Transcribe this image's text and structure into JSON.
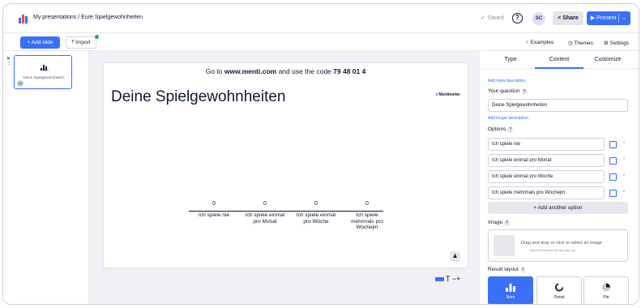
{
  "header": {
    "breadcrumb": "My presentations / Eure Spielgewohnheiten",
    "saved": "Saved",
    "help_glyph": "?",
    "avatar_initials": "SC",
    "share_label": "Share",
    "share_glyph": "<",
    "present_label": "Present",
    "present_glyph": "▶",
    "present_menu_glyph": "⌄",
    "check_glyph": "✓"
  },
  "toolbar": {
    "add_slide": "+ Add slide",
    "import": "Import",
    "import_glyph": "⤒",
    "examples": "Examples",
    "examples_glyph": "♀",
    "themes": "Themes",
    "themes_glyph": "◷",
    "settings": "Settings",
    "settings_glyph": "⚙"
  },
  "sidebar": {
    "slides": [
      {
        "number": "1",
        "title": "Deine Spielgewohnheiten",
        "avatar": "SC",
        "marker_glyph": "▶"
      }
    ]
  },
  "slide": {
    "banner_prefix": "Go to ",
    "banner_url": "www.menti.com",
    "banner_mid": " and use the code ",
    "banner_code": "79 48 01 4",
    "title": "Deine Spielgewohnheiten",
    "brand": "Mentimeter",
    "brand_glyph": "ıl",
    "user_glyph": "♟",
    "zoom_glyph": "T −+"
  },
  "chart_data": {
    "type": "bar",
    "categories": [
      "Ich spiele nie",
      "Ich spiele einmal pro Monat",
      "Ich spiele einmal pro Woche",
      "Ich spiele mehrmals pro Wochejm"
    ],
    "values": [
      0,
      0,
      0,
      0
    ]
  },
  "panel": {
    "tabs": [
      "Type",
      "Content",
      "Customize"
    ],
    "active_tab": "Content",
    "add_meta": "Add meta description",
    "question_label": "Your question",
    "question_value": "Deine Spielgewohnheiten",
    "add_longer": "Add longer description",
    "options_label": "Options",
    "options": [
      "Ich spiele nie",
      "Ich spiele einmal pro Monat",
      "Ich spiele einmal pro Woche",
      "Ich spiele mehrmals pro Wochejm"
    ],
    "remove_glyph": "×",
    "help_glyph": "?",
    "add_option": "+ Add another option",
    "image_label": "Image",
    "dropzone_text": "Drag and drop or click to select an image",
    "dropzone_sub": "Supported filetypes are jpg, png, svg",
    "result_layout_label": "Result layout",
    "layouts": [
      "Bars",
      "Donut",
      "Pie"
    ],
    "active_layout": "Bars"
  },
  "colors": {
    "accent": "#3a6ff7",
    "saved_check": "#27a85a",
    "text": "#101834"
  }
}
